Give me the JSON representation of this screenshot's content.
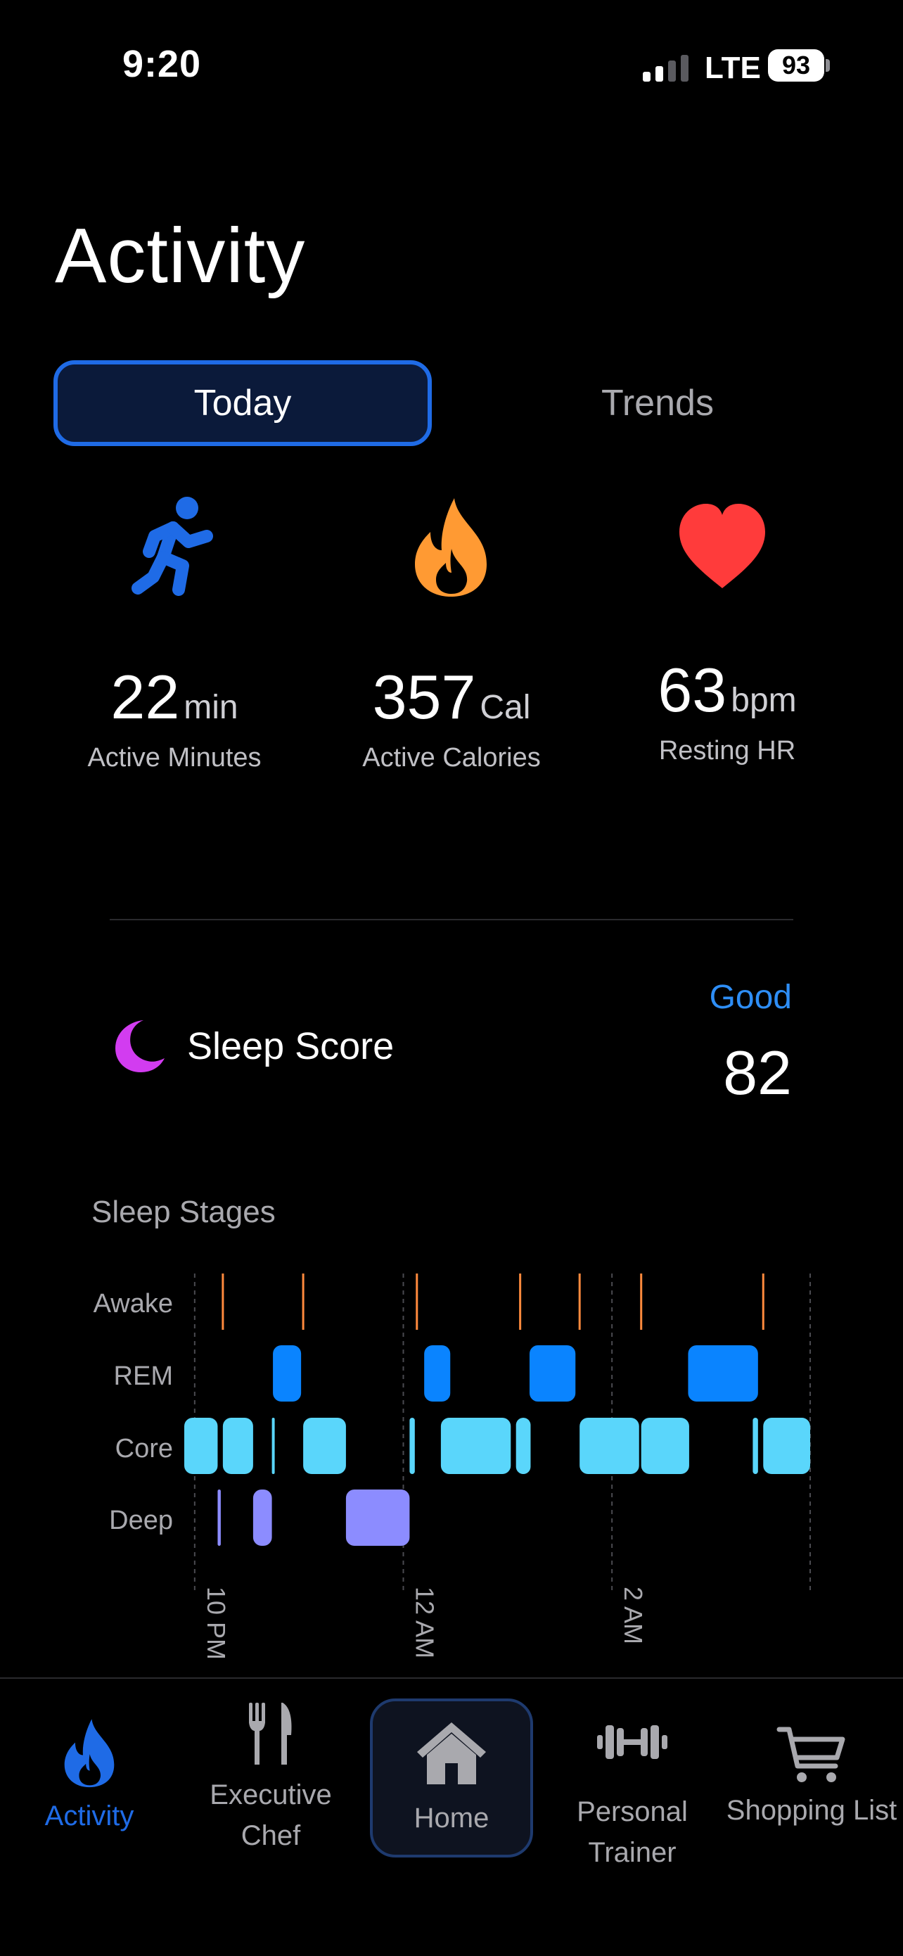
{
  "status_bar": {
    "time": "9:20",
    "network": "LTE",
    "battery": "93"
  },
  "page_title": "Activity",
  "segments": {
    "today": "Today",
    "trends": "Trends"
  },
  "stats": [
    {
      "icon": "running-figure-icon",
      "value": "22",
      "unit": "min",
      "label": "Active Minutes",
      "color": "#1f6be6"
    },
    {
      "icon": "flame-icon",
      "value": "357",
      "unit": "Cal",
      "label": "Active Calories",
      "color": "#ff9a33"
    },
    {
      "icon": "heart-icon",
      "value": "63",
      "unit": "bpm",
      "label": "Resting HR",
      "color": "#ff3b3b"
    }
  ],
  "sleep": {
    "title": "Sleep Score",
    "rating": "Good",
    "score": "82",
    "icon": "moon-icon",
    "icon_color": "#d23cf0"
  },
  "sleep_stages": {
    "title": "Sleep Stages",
    "stage_labels": [
      "Awake",
      "REM",
      "Core",
      "Deep"
    ],
    "time_labels": [
      "10 PM",
      "12 AM",
      "2 AM"
    ],
    "colors": {
      "awake": "#ff8a3d",
      "rem": "#0a84ff",
      "core": "#5ad6fb",
      "deep": "#8c8cff"
    },
    "chart_data": {
      "type": "timeline",
      "x_range_hours": [
        21.9,
        27.9
      ],
      "segments": [
        {
          "stage": "Awake",
          "start": 22.27,
          "end": 22.29
        },
        {
          "stage": "Awake",
          "start": 23.04,
          "end": 23.06
        },
        {
          "stage": "Awake",
          "start": 24.13,
          "end": 24.16
        },
        {
          "stage": "Awake",
          "start": 25.12,
          "end": 25.14
        },
        {
          "stage": "Awake",
          "start": 25.69,
          "end": 25.71
        },
        {
          "stage": "Awake",
          "start": 26.28,
          "end": 26.3
        },
        {
          "stage": "Awake",
          "start": 27.45,
          "end": 27.47
        },
        {
          "stage": "REM",
          "start": 22.75,
          "end": 23.02
        },
        {
          "stage": "REM",
          "start": 24.2,
          "end": 24.45
        },
        {
          "stage": "REM",
          "start": 25.21,
          "end": 25.65
        },
        {
          "stage": "REM",
          "start": 26.73,
          "end": 27.4
        },
        {
          "stage": "Core",
          "start": 21.9,
          "end": 22.22
        },
        {
          "stage": "Core",
          "start": 22.27,
          "end": 22.56
        },
        {
          "stage": "Core",
          "start": 22.74,
          "end": 22.75
        },
        {
          "stage": "Core",
          "start": 23.04,
          "end": 23.45
        },
        {
          "stage": "Core",
          "start": 24.06,
          "end": 24.11
        },
        {
          "stage": "Core",
          "start": 24.36,
          "end": 25.03
        },
        {
          "stage": "Core",
          "start": 25.08,
          "end": 25.22
        },
        {
          "stage": "Core",
          "start": 25.69,
          "end": 26.26
        },
        {
          "stage": "Core",
          "start": 26.28,
          "end": 26.74
        },
        {
          "stage": "Core",
          "start": 27.35,
          "end": 27.4
        },
        {
          "stage": "Core",
          "start": 27.45,
          "end": 27.9
        },
        {
          "stage": "Deep",
          "start": 22.22,
          "end": 22.25
        },
        {
          "stage": "Deep",
          "start": 22.56,
          "end": 22.74
        },
        {
          "stage": "Deep",
          "start": 23.45,
          "end": 24.06
        }
      ]
    }
  },
  "nav": {
    "items": [
      {
        "label": "Activity",
        "icon": "flame-icon",
        "active": true
      },
      {
        "label": "Executive\nChef",
        "icon": "fork-knife-icon"
      },
      {
        "label": "Home",
        "icon": "house-icon",
        "selected": true
      },
      {
        "label": "Personal\nTrainer",
        "icon": "dumbbell-icon"
      },
      {
        "label": "Shopping List",
        "icon": "cart-icon"
      }
    ],
    "active_color": "#1f6be6"
  }
}
